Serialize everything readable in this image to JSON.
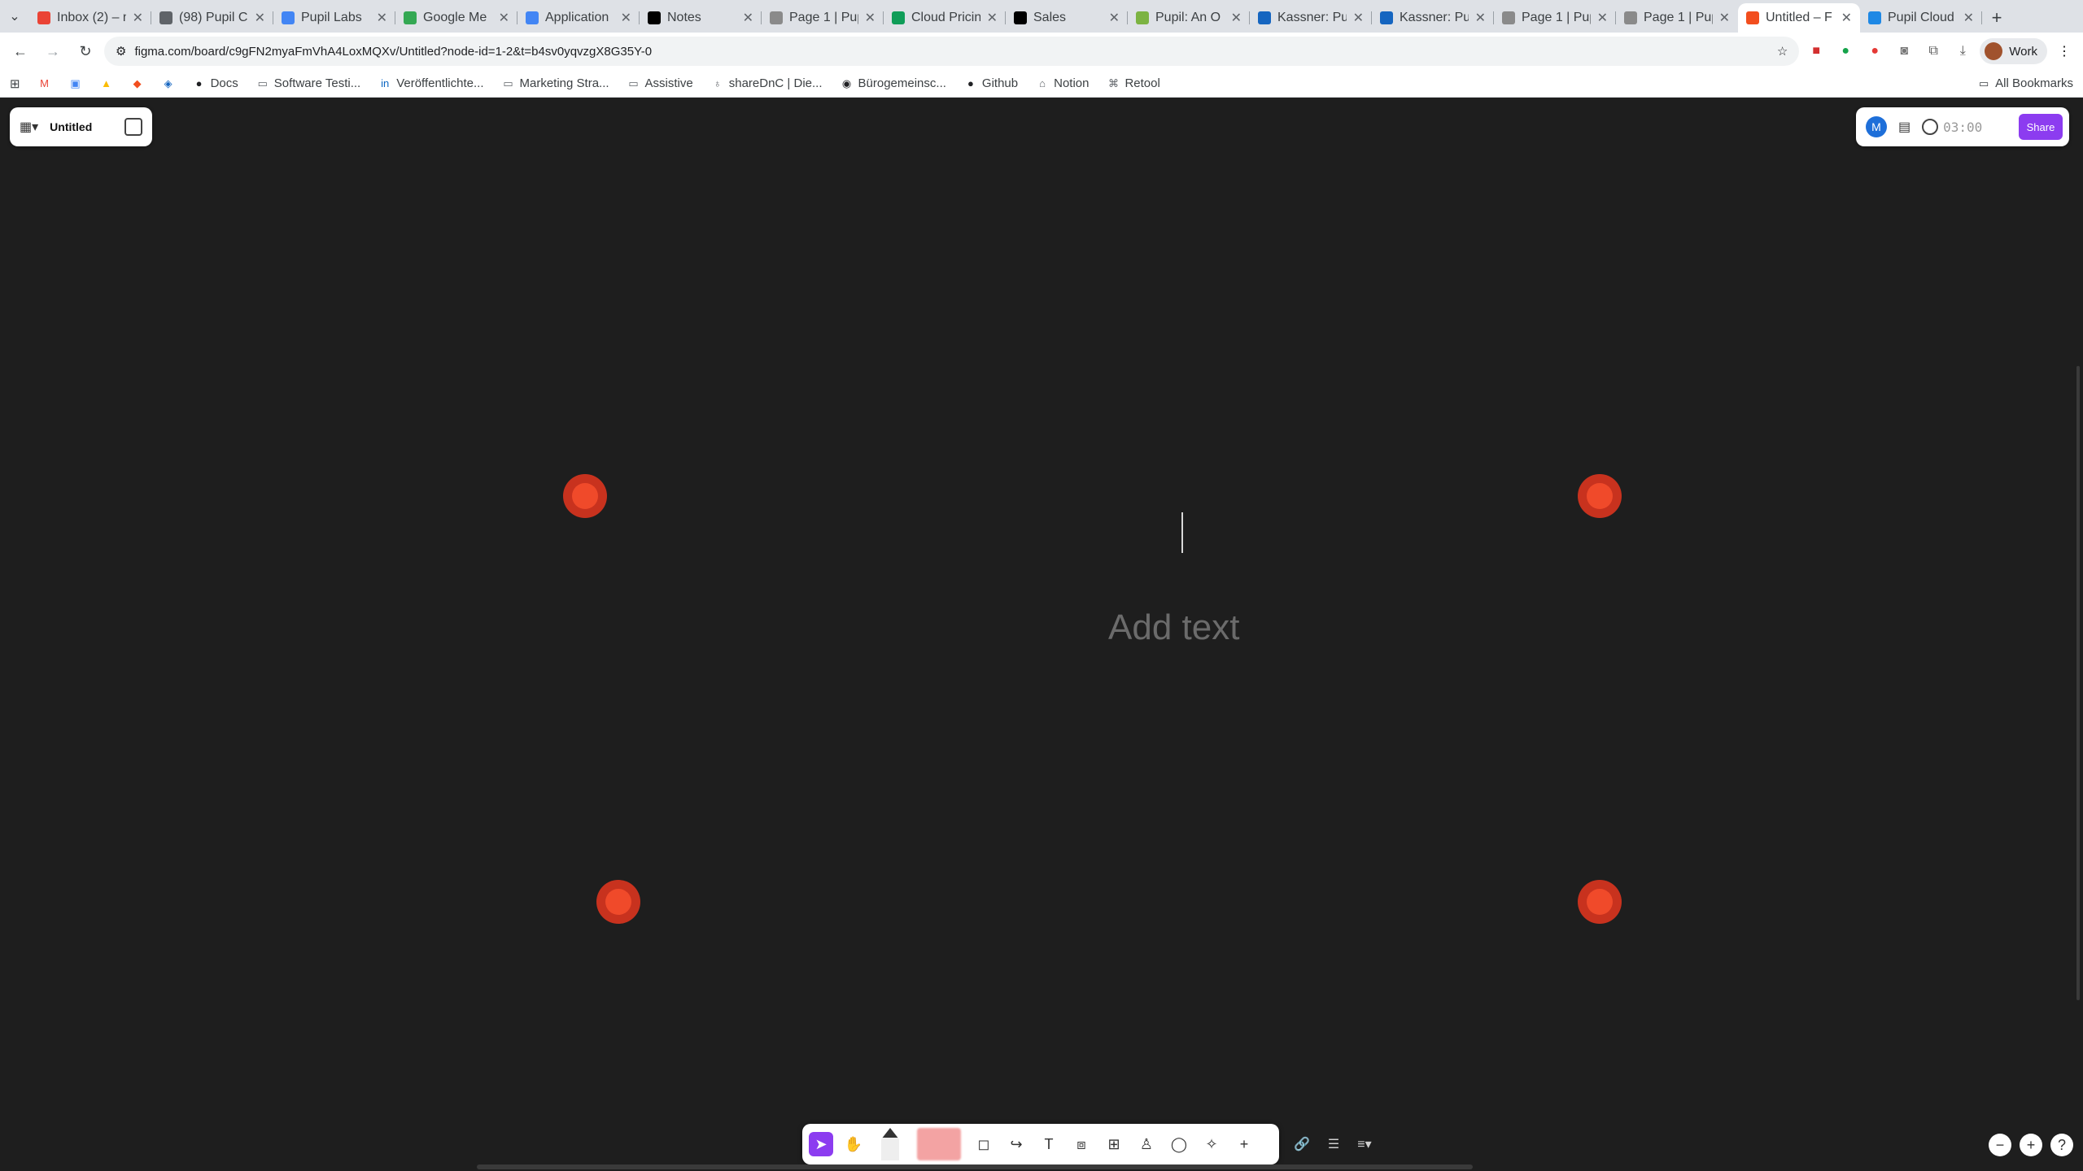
{
  "browser": {
    "tabs": [
      {
        "title": "Inbox (2) – n",
        "color": "#ea4335"
      },
      {
        "title": "(98) Pupil C",
        "color": "#5f6368"
      },
      {
        "title": "Pupil Labs",
        "color": "#4285f4"
      },
      {
        "title": "Google Me",
        "color": "#34a853"
      },
      {
        "title": "Application",
        "color": "#4285f4"
      },
      {
        "title": "Notes",
        "color": "#000000"
      },
      {
        "title": "Page 1 | Pup",
        "color": "#8a8a8a"
      },
      {
        "title": "Cloud Pricin",
        "color": "#0f9d58"
      },
      {
        "title": "Sales",
        "color": "#000000"
      },
      {
        "title": "Pupil: An O",
        "color": "#7cb342"
      },
      {
        "title": "Kassner: Pu",
        "color": "#1565c0"
      },
      {
        "title": "Kassner: Pu",
        "color": "#1565c0"
      },
      {
        "title": "Page 1 | Pup",
        "color": "#8a8a8a"
      },
      {
        "title": "Page 1 | Pup",
        "color": "#8a8a8a"
      },
      {
        "title": "Untitled – F",
        "color": "#f24e1e"
      },
      {
        "title": "Pupil Cloud",
        "color": "#1e88e5"
      }
    ],
    "url": "figma.com/board/c9gFN2myaFmVhA4LoxMQXv/Untitled?node-id=1-2&t=b4sv0yqvzgX8G35Y-0",
    "profile_label": "Work",
    "bookmarks": [
      {
        "label": "",
        "icon": "gmail-icon"
      },
      {
        "label": "",
        "icon": "calendar-icon"
      },
      {
        "label": "",
        "icon": "drive-icon"
      },
      {
        "label": "",
        "icon": "figma-icon"
      },
      {
        "label": "",
        "icon": "deploy-icon"
      },
      {
        "label": "Docs",
        "icon": "docs-icon"
      },
      {
        "label": "Software Testi...",
        "icon": "folder-icon"
      },
      {
        "label": "Veröffentlichte...",
        "icon": "linkedin-icon"
      },
      {
        "label": "Marketing Stra...",
        "icon": "folder-icon"
      },
      {
        "label": "Assistive",
        "icon": "folder-icon"
      },
      {
        "label": "shareDnC | Die...",
        "icon": "share-icon"
      },
      {
        "label": "Bürogemeinsc...",
        "icon": "pin-icon"
      },
      {
        "label": "Github",
        "icon": "github-icon"
      },
      {
        "label": "Notion",
        "icon": "home-icon"
      },
      {
        "label": "Retool",
        "icon": "retool-icon"
      }
    ],
    "all_bookmarks": "All Bookmarks"
  },
  "figma": {
    "file_name": "Untitled",
    "user_initial": "M",
    "timer": "03:00",
    "share_label": "Share",
    "canvas_placeholder": "Add text"
  }
}
